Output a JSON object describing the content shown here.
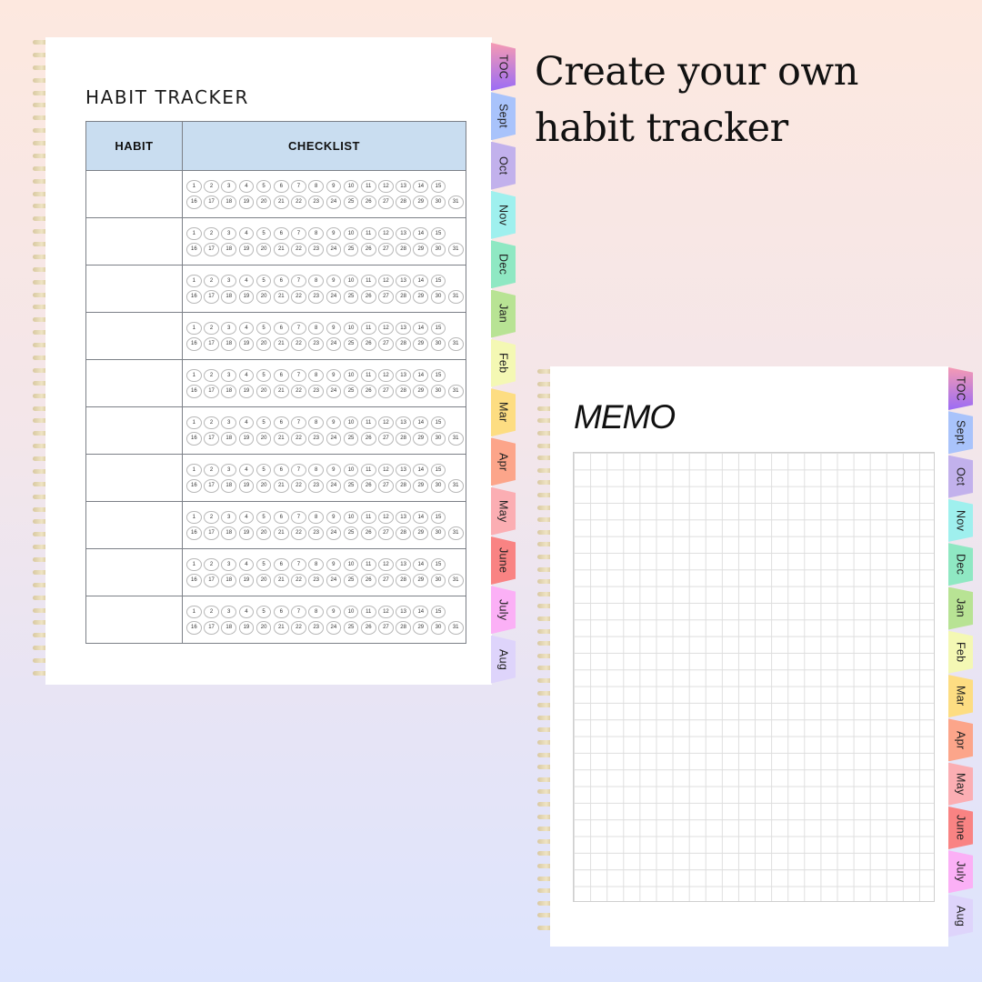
{
  "headline": {
    "line1": "Create your own",
    "line2": "habit tracker"
  },
  "habit_page": {
    "title": "HABIT TRACKER",
    "columns": [
      "HABIT",
      "CHECKLIST"
    ],
    "row_count": 10,
    "day_rows": [
      [
        "1",
        "2",
        "3",
        "4",
        "5",
        "6",
        "7",
        "8",
        "9",
        "10",
        "11",
        "12",
        "13",
        "14",
        "15"
      ],
      [
        "16",
        "17",
        "18",
        "19",
        "20",
        "21",
        "22",
        "23",
        "24",
        "25",
        "26",
        "27",
        "28",
        "29",
        "30",
        "31"
      ]
    ],
    "habits": [
      "",
      "",
      "",
      "",
      "",
      "",
      "",
      "",
      "",
      ""
    ]
  },
  "memo_page": {
    "title": "MEMO",
    "grid": {
      "columns": 22,
      "rows": 27
    }
  },
  "tabs": [
    {
      "label": "TOC",
      "color": "#f59ab3",
      "color2": "#9b6cf5"
    },
    {
      "label": "Sept",
      "color": "#a9c3fb",
      "color2": "#a9c3fb"
    },
    {
      "label": "Oct",
      "color": "#c2b1ec",
      "color2": "#c2b1ec"
    },
    {
      "label": "Nov",
      "color": "#9ff0ee",
      "color2": "#9ff0ee"
    },
    {
      "label": "Dec",
      "color": "#8fe8c3",
      "color2": "#8fe8c3"
    },
    {
      "label": "Jan",
      "color": "#b8e394",
      "color2": "#b8e394"
    },
    {
      "label": "Feb",
      "color": "#f4f8b4",
      "color2": "#f4f8b4"
    },
    {
      "label": "Mar",
      "color": "#fddd82",
      "color2": "#fddd82"
    },
    {
      "label": "Apr",
      "color": "#fca58a",
      "color2": "#fca58a"
    },
    {
      "label": "May",
      "color": "#fbaeb3",
      "color2": "#fbaeb3"
    },
    {
      "label": "June",
      "color": "#f98383",
      "color2": "#f98383"
    },
    {
      "label": "July",
      "color": "#fbb0f6",
      "color2": "#fbb0f6"
    },
    {
      "label": "Aug",
      "color": "#ded4fb",
      "color2": "#ded4fb"
    }
  ]
}
